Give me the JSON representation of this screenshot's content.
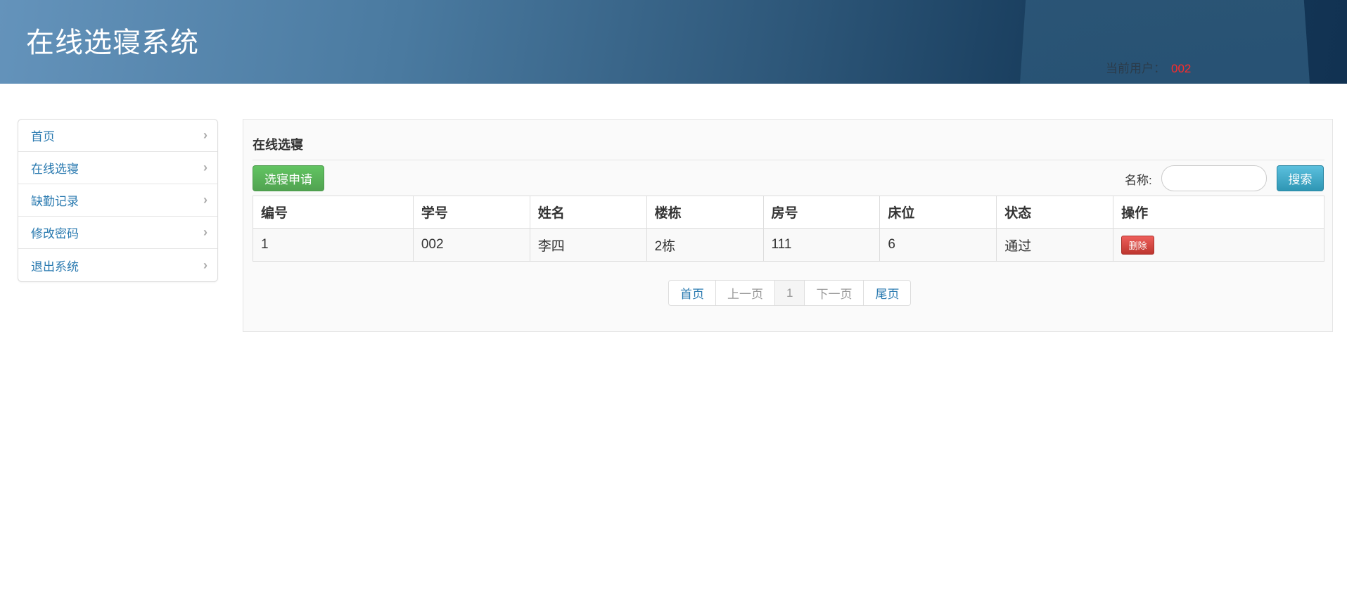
{
  "header": {
    "title": "在线选寝系统",
    "user_label": "当前用户：",
    "user_id": "002"
  },
  "sidebar": {
    "items": [
      {
        "label": "首页"
      },
      {
        "label": "在线选寝"
      },
      {
        "label": "缺勤记录"
      },
      {
        "label": "修改密码"
      },
      {
        "label": "退出系统"
      }
    ]
  },
  "main": {
    "section_title": "在线选寝",
    "apply_button": "选寝申请",
    "search_label": "名称:",
    "search_value": "",
    "search_button": "搜索",
    "table": {
      "columns": [
        "编号",
        "学号",
        "姓名",
        "楼栋",
        "房号",
        "床位",
        "状态",
        "操作"
      ],
      "rows": [
        {
          "id": "1",
          "student_no": "002",
          "name": "李四",
          "building": "2栋",
          "room": "111",
          "bed": "6",
          "status": "通过",
          "action": "删除"
        }
      ]
    },
    "pagination": {
      "first": "首页",
      "prev": "上一页",
      "current": "1",
      "next": "下一页",
      "last": "尾页"
    }
  },
  "colors": {
    "accent_link": "#2a7ab0",
    "user_id": "#ff2a2a",
    "success": "#51a351",
    "info": "#2f96b4",
    "danger": "#bd362f"
  }
}
